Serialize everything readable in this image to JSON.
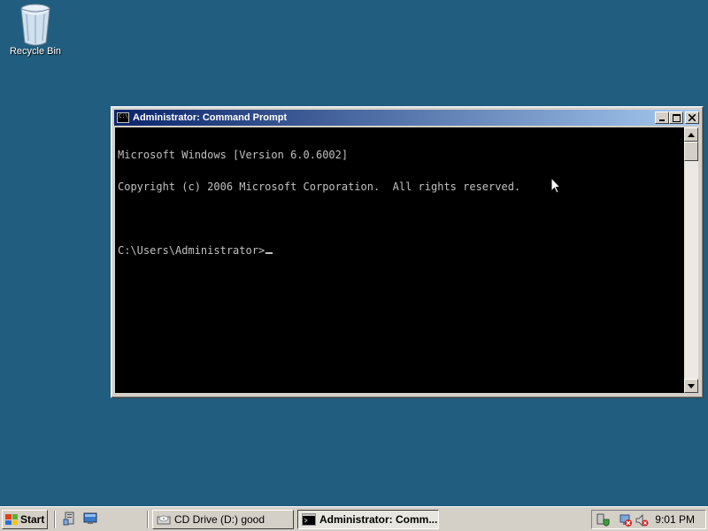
{
  "desktop": {
    "icons": [
      {
        "label": "Recycle Bin",
        "icon": "recycle-bin-icon"
      }
    ]
  },
  "window": {
    "title": "Administrator: Command Prompt",
    "buttons": {
      "minimize": "_",
      "maximize": "□",
      "close": "×"
    },
    "console_lines": [
      "Microsoft Windows [Version 6.0.6002]",
      "Copyright (c) 2006 Microsoft Corporation.  All rights reserved.",
      "",
      "C:\\Users\\Administrator>"
    ],
    "colors": {
      "background": "#000000",
      "text": "#c0c0c0",
      "title_start": "#0a246a",
      "title_end": "#a6caf0"
    }
  },
  "taskbar": {
    "start_label": "Start",
    "tasks": [
      {
        "label": "CD Drive (D:) good",
        "icon": "cd-drive-icon",
        "active": false
      },
      {
        "label": "Administrator: Comm...",
        "icon": "command-prompt-icon",
        "active": true
      }
    ],
    "clock": "9:01 PM"
  },
  "desktop_color": "#215d7e"
}
